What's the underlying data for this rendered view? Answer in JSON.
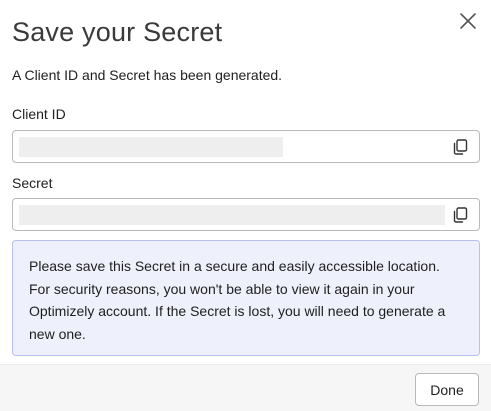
{
  "dialog": {
    "title": "Save your Secret",
    "intro": "A Client ID and Secret has been generated.",
    "close_icon": "close-icon"
  },
  "client_id": {
    "label": "Client ID",
    "value": "",
    "copy_icon": "copy-icon"
  },
  "secret": {
    "label": "Secret",
    "value": "",
    "copy_icon": "copy-icon"
  },
  "notice": {
    "text": "Please save this Secret in a secure and easily accessible location. For security reasons, you won't be able to view it again in your Optimizely account. If the Secret is lost, you will need to generate a new one."
  },
  "footer": {
    "done_label": "Done"
  },
  "colors": {
    "notice_background": "#eef0fc",
    "notice_border": "#b6c0ee",
    "footer_background": "#f6f6f6",
    "field_border": "#b9b9b9"
  }
}
